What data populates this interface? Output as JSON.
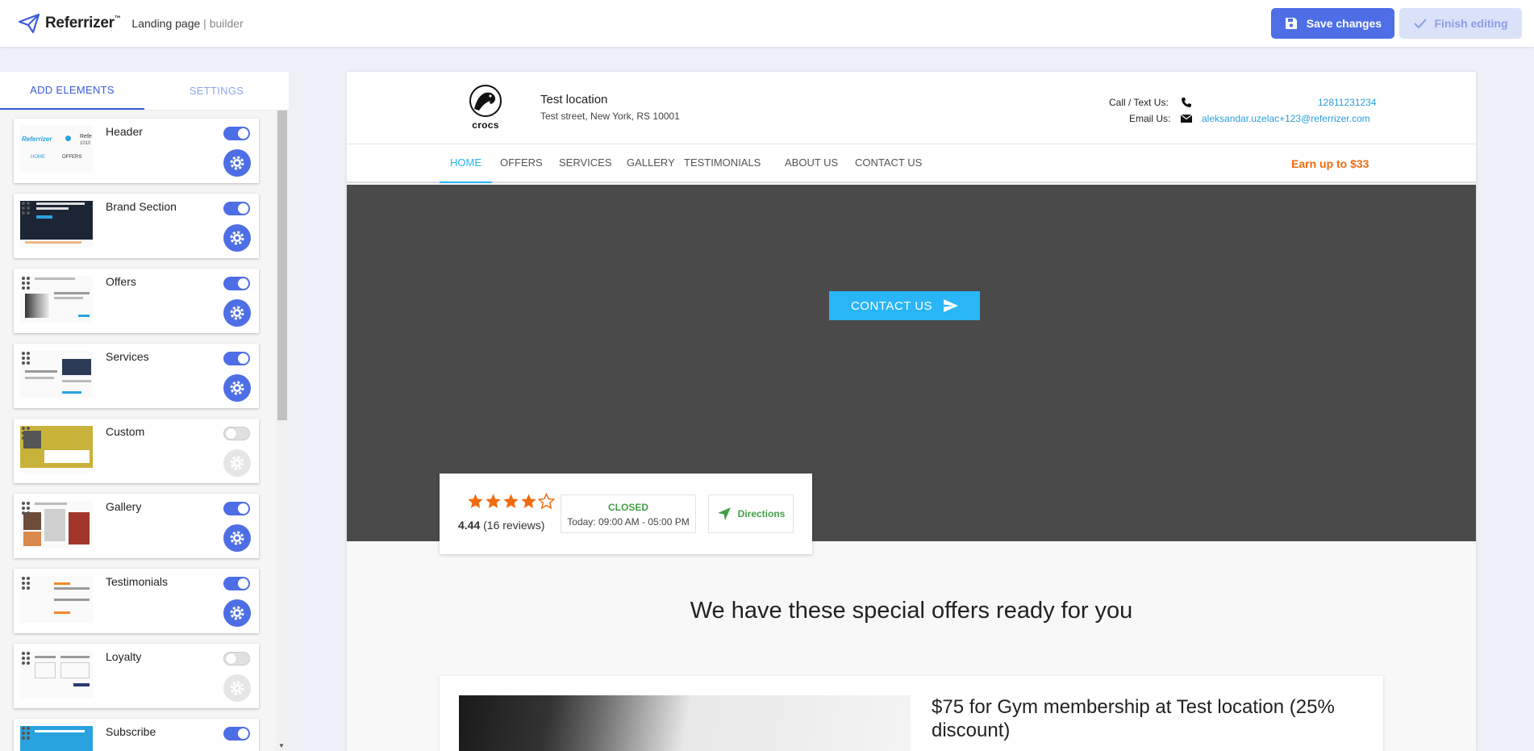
{
  "app": {
    "name": "Referrizer",
    "tm": "™",
    "page_title": "Landing page",
    "page_sep": " | ",
    "page_sub": "builder",
    "save_label": "Save changes",
    "finish_label": "Finish editing",
    "accent": "#4e6ee6"
  },
  "left_panel": {
    "tabs": [
      {
        "label": "ADD ELEMENTS",
        "active": true
      },
      {
        "label": "SETTINGS",
        "active": false
      }
    ],
    "elements": [
      {
        "title": "Header",
        "enabled": true
      },
      {
        "title": "Brand Section",
        "enabled": true
      },
      {
        "title": "Offers",
        "enabled": true
      },
      {
        "title": "Services",
        "enabled": true
      },
      {
        "title": "Custom",
        "enabled": false
      },
      {
        "title": "Gallery",
        "enabled": true
      },
      {
        "title": "Testimonials",
        "enabled": true
      },
      {
        "title": "Loyalty",
        "enabled": false
      },
      {
        "title": "Subscribe",
        "enabled": true
      }
    ],
    "thumb_header": {
      "logo": "Referrizer",
      "nav1": "HOME",
      "nav2": "OFFERS",
      "extra": "Refe",
      "extra2": "1010"
    }
  },
  "site": {
    "brand_logo_text": "crocs",
    "location_name": "Test location",
    "address": "Test street, New York, RS 10001",
    "call_label": "Call / Text Us:",
    "phone": "12811231234",
    "email_label": "Email Us:",
    "email": "aleksandar.uzelac+123@referrizer.com",
    "nav": [
      "HOME",
      "OFFERS",
      "SERVICES",
      "GALLERY",
      "TESTIMONIALS",
      "ABOUT US",
      "CONTACT US"
    ],
    "earn": "Earn up to $33",
    "hero_cta": "CONTACT US",
    "rating": {
      "value": "4.44",
      "reviews": "(16 reviews)",
      "stars_filled": 4,
      "stars_total": 5
    },
    "hours": {
      "status": "CLOSED",
      "today": "Today: 09:00 AM - 05:00 PM"
    },
    "directions": "Directions",
    "offers_heading": "We have these special offers ready for you",
    "offer_title": "$75 for Gym membership at Test location (25% discount)"
  }
}
